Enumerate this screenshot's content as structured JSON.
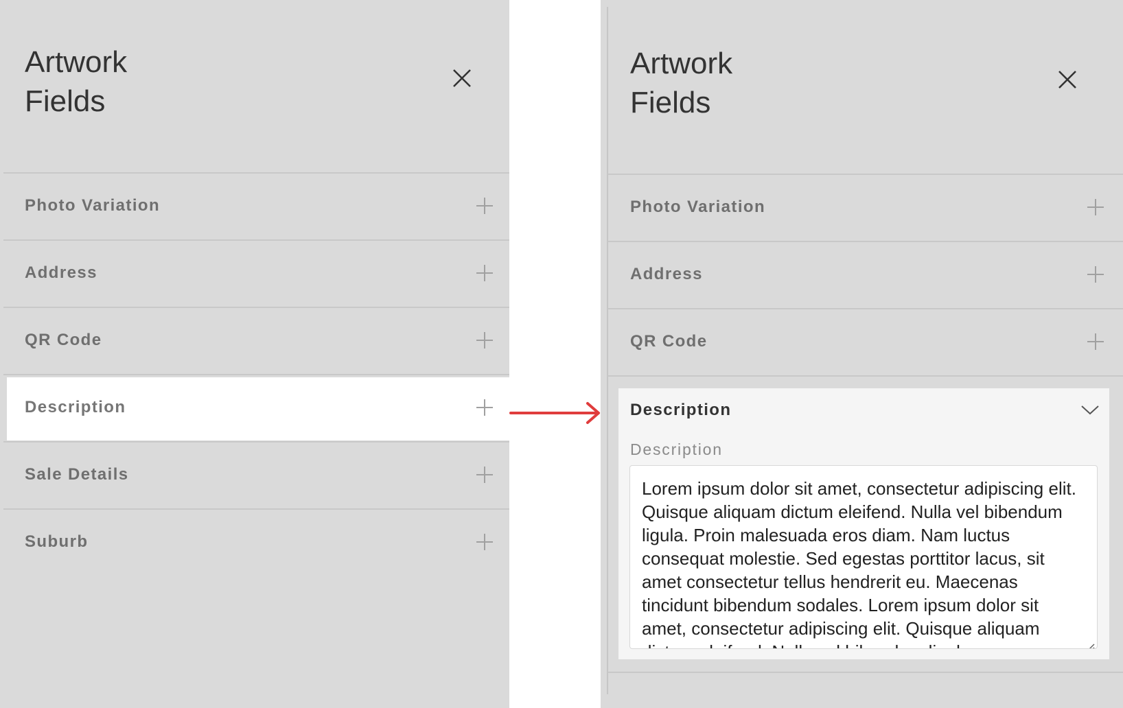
{
  "left_panel": {
    "title_line1": "Artwork",
    "title_line2": "Fields",
    "close_icon": "close-icon",
    "items": [
      {
        "label": "Photo Variation",
        "icon": "plus-icon"
      },
      {
        "label": "Address",
        "icon": "plus-icon"
      },
      {
        "label": "QR Code",
        "icon": "plus-icon"
      },
      {
        "label": "Description",
        "icon": "plus-icon",
        "highlighted": true
      },
      {
        "label": "Sale Details",
        "icon": "plus-icon"
      },
      {
        "label": "Suburb",
        "icon": "plus-icon"
      }
    ]
  },
  "transition_arrow": {
    "icon": "arrow-right-icon",
    "color": "#e03c3c"
  },
  "right_panel": {
    "title_line1": "Artwork",
    "title_line2": "Fields",
    "close_icon": "close-icon",
    "items": [
      {
        "label": "Photo Variation",
        "icon": "plus-icon"
      },
      {
        "label": "Address",
        "icon": "plus-icon"
      },
      {
        "label": "QR Code",
        "icon": "plus-icon"
      }
    ],
    "expanded": {
      "title": "Description",
      "icon": "chevron-down-icon",
      "field_label": "Description",
      "field_value": "Lorem ipsum dolor sit amet, consectetur adipiscing elit. Quisque aliquam dictum eleifend. Nulla vel bibendum ligula. Proin malesuada eros diam. Nam luctus consequat molestie. Sed egestas porttitor lacus, sit amet consectetur tellus hendrerit eu. Maecenas tincidunt bibendum sodales. Lorem ipsum dolor sit amet, consectetur adipiscing elit. Quisque aliquam dictum eleifend. Nulla vel bibendum ligula."
    }
  },
  "colors": {
    "panel_bg": "#dadada",
    "divider": "#c8c8c8",
    "highlight_bg": "#ffffff",
    "card_bg": "#f5f5f5",
    "label_text": "#6f6f6f",
    "title_text": "#333333"
  }
}
